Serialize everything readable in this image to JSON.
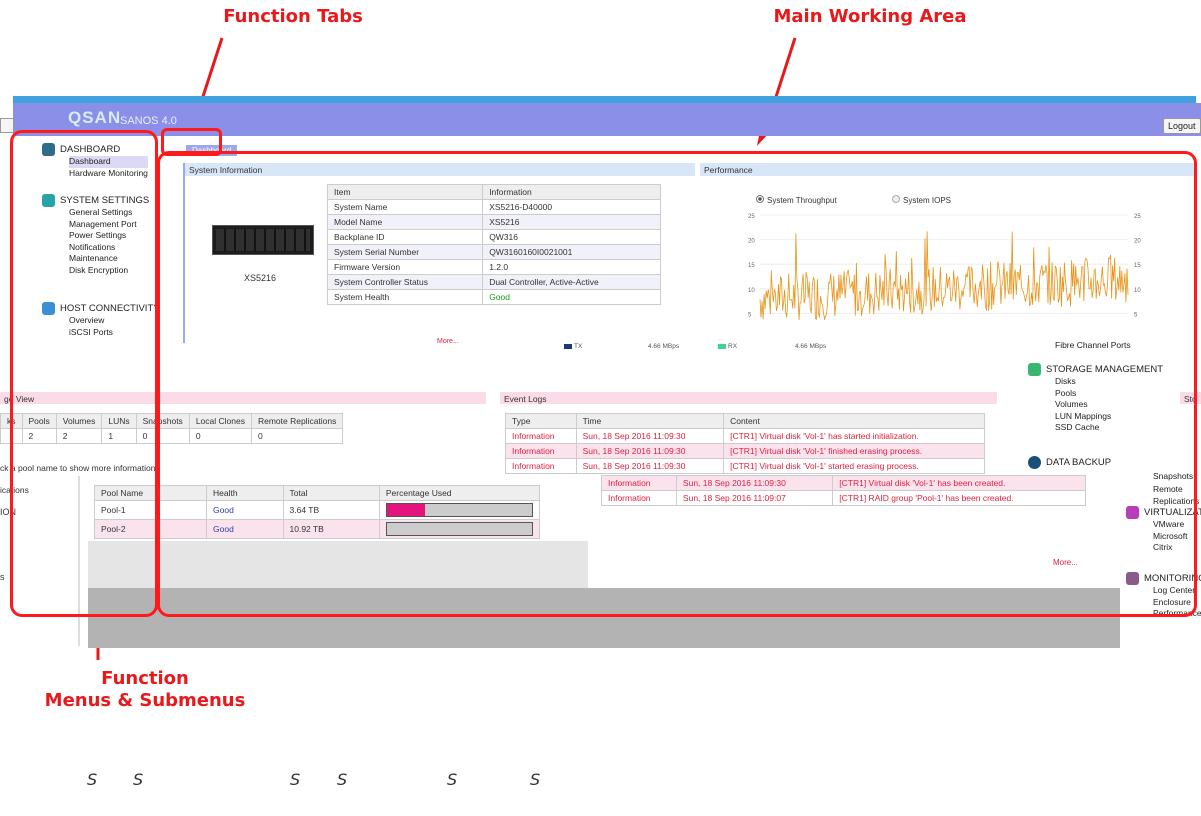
{
  "callouts": {
    "function_tabs": "Function Tabs",
    "main_working_area": "Main Working Area",
    "function_menus_line1": "Function",
    "function_menus_line2": "Menus & Submenus"
  },
  "header": {
    "logo": "QSAN",
    "version": "SANOS 4.0",
    "logout": "Logout",
    "tab": "Dashboard"
  },
  "menu": {
    "dashboard": {
      "title": "DASHBOARD",
      "items": [
        "Dashboard",
        "Hardware Monitoring"
      ]
    },
    "system_settings": {
      "title": "SYSTEM SETTINGS",
      "items": [
        "General Settings",
        "Management Port",
        "Power Settings",
        "Notifications",
        "Maintenance",
        "Disk Encryption"
      ]
    },
    "host_connectivity": {
      "title": "HOST CONNECTIVITY",
      "items": [
        "Overview",
        "iSCSI Ports",
        "Fibre Channel Ports"
      ]
    },
    "storage_management": {
      "title": "STORAGE MANAGEMENT",
      "items": [
        "Disks",
        "Pools",
        "Volumes",
        "LUN Mappings",
        "SSD Cache"
      ]
    },
    "data_backup": {
      "title": "DATA BACKUP",
      "items": [
        "Snapshots",
        "Remote Replications"
      ]
    },
    "virtualization": {
      "title": "VIRTUALIZATION",
      "items": [
        "VMware",
        "Microsoft",
        "Citrix"
      ]
    },
    "monitoring": {
      "title": "MONITORING",
      "items": [
        "Log Center",
        "Enclosure",
        "Performance"
      ]
    }
  },
  "system_info": {
    "title": "System Information",
    "device": "XS5216",
    "more": "More...",
    "columns": [
      "Item",
      "Information"
    ],
    "rows": [
      [
        "System Name",
        "XS5216-D40000"
      ],
      [
        "Model Name",
        "XS5216"
      ],
      [
        "Backplane ID",
        "QW316"
      ],
      [
        "System Serial Number",
        "QW3160160I0021001"
      ],
      [
        "Firmware Version",
        "1.2.0"
      ],
      [
        "System Controller Status",
        "Dual Controller, Active-Active"
      ],
      [
        "System Health",
        "Good"
      ]
    ],
    "colors": {
      "health_good": "#1a9b1a"
    }
  },
  "performance": {
    "title": "Performance",
    "radio_throughput": "System Throughput",
    "radio_iops": "System IOPS",
    "tx_label": "TX",
    "tx_value": "4.66 MBps",
    "rx_label": "RX",
    "rx_value": "4.66 MBps",
    "series_color": "#e8941a",
    "y_ticks": [
      "25",
      "20",
      "15",
      "10",
      "5"
    ]
  },
  "storage_view": {
    "title": "ge View",
    "columns": [
      "ks",
      "Pools",
      "Volumes",
      "LUNs",
      "Snapshots",
      "Local Clones",
      "Remote Replications"
    ],
    "values": [
      "",
      "2",
      "2",
      "1",
      "0",
      "0",
      "0"
    ],
    "hint": "ck a pool name to show more information.",
    "side_labels": [
      "ications",
      "ION",
      "s"
    ]
  },
  "pools": {
    "columns": [
      "Pool Name",
      "Health",
      "Total",
      "Percentage Used"
    ],
    "rows": [
      {
        "name": "Pool-1",
        "health": "Good",
        "total": "3.64 TB",
        "used": 0.26
      },
      {
        "name": "Pool-2",
        "health": "Good",
        "total": "10.92 TB",
        "used": 0
      }
    ],
    "bar_color": "#e5137d"
  },
  "event_logs": {
    "title": "Event Logs",
    "columns": [
      "Type",
      "Time",
      "Content"
    ],
    "rows": [
      [
        "Information",
        "Sun, 18 Sep 2016 11:09:30",
        "[CTR1] Virtual disk 'Vol-1' has started initialization."
      ],
      [
        "Information",
        "Sun, 18 Sep 2016 11:09:30",
        "[CTR1] Virtual disk 'Vol-1' finished erasing process."
      ],
      [
        "Information",
        "Sun, 18 Sep 2016 11:09:30",
        "[CTR1] Virtual disk 'Vol-1' started erasing process."
      ],
      [
        "Information",
        "Sun, 18 Sep 2016 11:09:30",
        "[CTR1] Virtual disk 'Vol-1' has been created."
      ],
      [
        "Information",
        "Sun, 18 Sep 2016 11:09:07",
        "[CTR1] RAID group 'Pool-1' has been created."
      ]
    ],
    "more": "More..."
  },
  "right_edge": {
    "label": "Sto"
  },
  "footer_letters": [
    "S",
    "S",
    "S",
    "S",
    "S",
    "S"
  ]
}
